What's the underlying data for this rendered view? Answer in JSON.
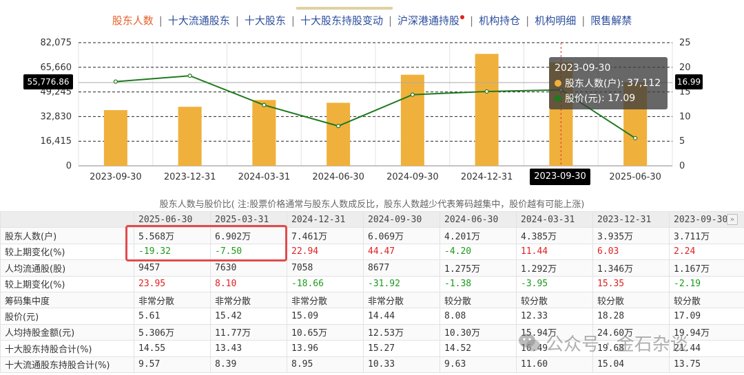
{
  "nav": {
    "items": [
      {
        "label": "股东人数",
        "active": true
      },
      {
        "label": "十大流通股东"
      },
      {
        "label": "十大股东"
      },
      {
        "label": "十大股东持股变动"
      },
      {
        "label": "沪深港通持股",
        "dot": true
      },
      {
        "label": "机构持仓"
      },
      {
        "label": "机构明细"
      },
      {
        "label": "限售解禁"
      }
    ]
  },
  "chart_data": {
    "type": "bar",
    "categories": [
      "2023-09-30",
      "2023-12-31",
      "2024-03-31",
      "2024-06-30",
      "2024-09-30",
      "2024-12-31",
      "2025-03-31",
      "2025-06-30"
    ],
    "x_tick_labels": [
      "2023-09-30",
      "2023-12-31",
      "2024-03-31",
      "2024-06-30",
      "2024-09-30",
      "2024-12-31",
      "2023-09-30",
      "2025-06-30"
    ],
    "series": [
      {
        "name": "股东人数(户)",
        "kind": "bar",
        "axis": "left",
        "color": "#f0b03c",
        "values": [
          37112,
          39350,
          43850,
          42010,
          60690,
          74610,
          69020,
          55680
        ]
      },
      {
        "name": "股价(元)",
        "kind": "line",
        "axis": "right",
        "color": "#1e7a1e",
        "values": [
          17.09,
          18.28,
          12.33,
          8.08,
          14.44,
          15.09,
          15.42,
          5.61
        ]
      }
    ],
    "y_left": {
      "ticks": [
        "0",
        "16,415",
        "32,830",
        "49,245",
        "65,660",
        "82,075"
      ],
      "ylim": [
        0,
        82075
      ]
    },
    "y_right": {
      "ticks": [
        "0",
        "5",
        "10",
        "15",
        "20",
        "25"
      ],
      "ylim": [
        0,
        25
      ]
    },
    "grid": "dashed-horizontal",
    "highlighted_category": 6,
    "crosshair": {
      "left_value": "55,776.86",
      "right_value": "16.99",
      "x_label": "2023-09-30"
    },
    "tooltip": {
      "title": "2023-09-30",
      "rows": [
        {
          "name": "股东人数(户)",
          "value": "37,112",
          "color": "#f0b03c"
        },
        {
          "name": "股价(元)",
          "value": "17.09",
          "color": "#1e7a1e"
        }
      ]
    },
    "caption": "股东人数与股价比( 注:股票价格通常与股东人数成反比，股东人数越少代表筹码越集中，股价越有可能上涨)"
  },
  "table": {
    "headers": [
      "",
      "2025-06-30",
      "2025-03-31",
      "2024-12-31",
      "2024-09-30",
      "2024-06-30",
      "2024-03-31",
      "2023-12-31",
      "2023-09-30"
    ],
    "rows": [
      {
        "label": "股东人数(户)",
        "cells": [
          "5.568万",
          "6.902万",
          "7.461万",
          "6.069万",
          "4.201万",
          "4.385万",
          "3.935万",
          "3.711万"
        ]
      },
      {
        "label": "较上期变化(%)",
        "cells": [
          "-19.32",
          "-7.50",
          "22.94",
          "44.47",
          "-4.20",
          "11.44",
          "6.03",
          "2.24"
        ]
      },
      {
        "label": "人均流通股(股)",
        "cells": [
          "9457",
          "7630",
          "7058",
          "8677",
          "1.275万",
          "1.292万",
          "1.346万",
          "1.167万"
        ]
      },
      {
        "label": "较上期变化(%)",
        "cells": [
          "23.95",
          "8.10",
          "-18.66",
          "-31.92",
          "-1.38",
          "-3.95",
          "15.35",
          "-2.19"
        ]
      },
      {
        "label": "筹码集中度",
        "cells": [
          "非常分散",
          "非常分散",
          "非常分散",
          "非常分散",
          "较分散",
          "较分散",
          "较分散",
          "较分散"
        ]
      },
      {
        "label": "股价(元)",
        "cells": [
          "5.61",
          "15.42",
          "15.09",
          "14.44",
          "8.08",
          "12.33",
          "18.28",
          "17.09"
        ]
      },
      {
        "label": "人均持股金额(元)",
        "cells": [
          "5.306万",
          "11.77万",
          "10.65万",
          "12.53万",
          "10.30万",
          "15.94万",
          "24.60万",
          "19.94万"
        ]
      },
      {
        "label": "十大股东持股合计(%)",
        "cells": [
          "14.55",
          "13.43",
          "13.96",
          "15.27",
          "14.52",
          "16.49",
          "19.68",
          "21.44"
        ]
      },
      {
        "label": "十大流通股东持股合计(%)",
        "cells": [
          "9.57",
          "8.39",
          "8.95",
          "10.33",
          "9.63",
          "11.60",
          "15.04",
          "13.75"
        ]
      }
    ]
  },
  "scroll": {
    "icon": "double-chevron-right-icon",
    "glyph": "»"
  },
  "watermark": {
    "icon": "wechat-icon",
    "text": "公众号 · 金石杂谈"
  }
}
